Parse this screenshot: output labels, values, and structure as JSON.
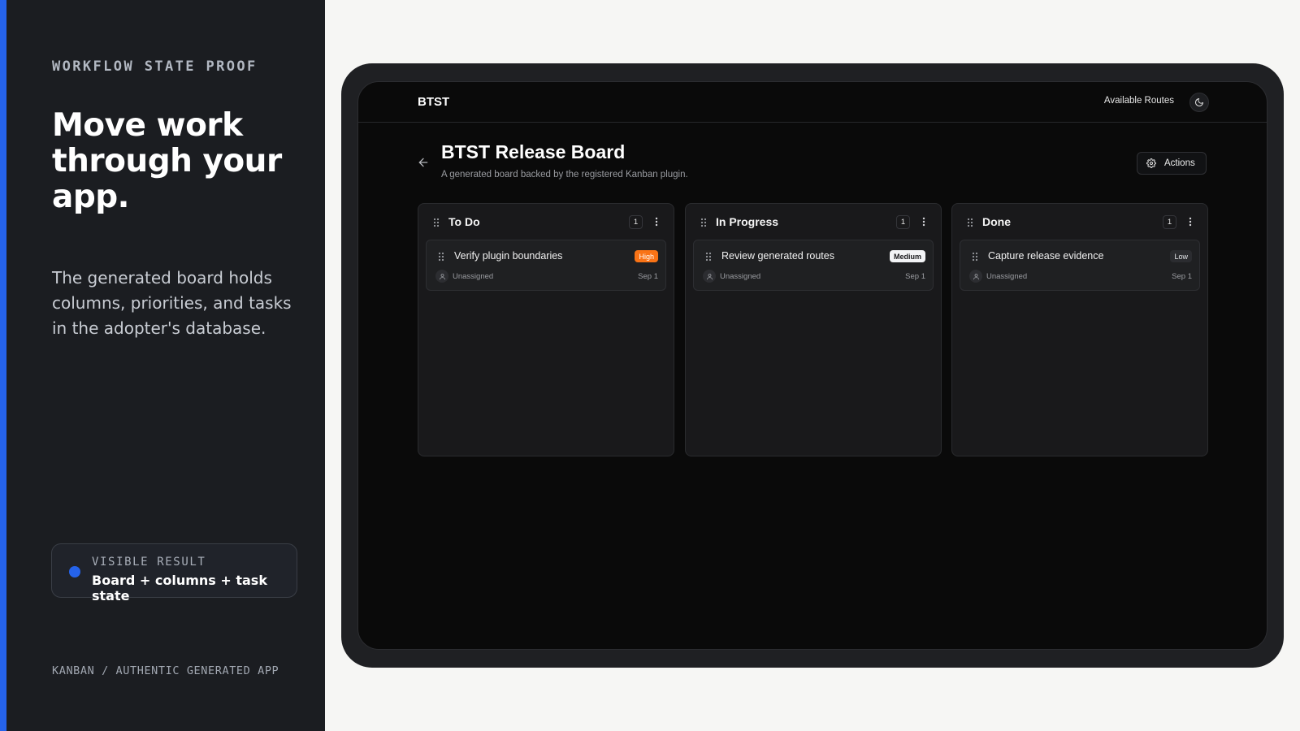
{
  "left": {
    "eyebrow": "WORKFLOW STATE PROOF",
    "title": "Move work through your app.",
    "description": "The generated board holds columns, priorities, and tasks in the adopter's database.",
    "result_label": "VISIBLE RESULT",
    "result_value": "Board + columns + task state",
    "footer": "KANBAN / AUTHENTIC GENERATED APP",
    "accent_color": "#2563eb"
  },
  "app": {
    "brand": "BTST",
    "routes_link": "Available Routes",
    "theme_icon": "moon-icon"
  },
  "board": {
    "title": "BTST Release Board",
    "subtitle": "A generated board backed by the registered Kanban plugin.",
    "actions_label": "Actions",
    "columns": [
      {
        "title": "To Do",
        "count": "1",
        "task": {
          "title": "Verify plugin boundaries",
          "priority": "High",
          "assignee": "Unassigned",
          "due": "Sep 1"
        }
      },
      {
        "title": "In Progress",
        "count": "1",
        "task": {
          "title": "Review generated routes",
          "priority": "Medium",
          "assignee": "Unassigned",
          "due": "Sep 1"
        }
      },
      {
        "title": "Done",
        "count": "1",
        "task": {
          "title": "Capture release evidence",
          "priority": "Low",
          "assignee": "Unassigned",
          "due": "Sep 1"
        }
      }
    ]
  },
  "colors": {
    "priority_high": "#f97316",
    "priority_medium": "#f3f4f6",
    "priority_low": "#2b2c30"
  }
}
